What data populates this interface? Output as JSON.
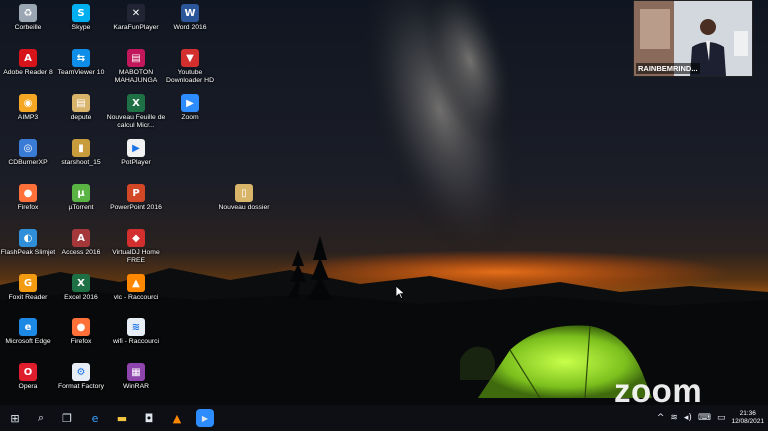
{
  "desktop": {
    "icons": [
      {
        "label": "Corbeille",
        "icon": "recycle-bin-icon",
        "color": "#9aa7b3",
        "glyph": "♻"
      },
      {
        "label": "Skype",
        "icon": "skype-icon",
        "color": "#00aff0",
        "glyph": "S"
      },
      {
        "label": "KaraFunPlayer",
        "icon": "karafun-icon",
        "color": "#202433",
        "glyph": "✕"
      },
      {
        "label": "Word 2016",
        "icon": "word-icon",
        "color": "#2b579a",
        "glyph": "W"
      },
      {
        "label": "Adobe Reader 8",
        "icon": "adobe-reader-icon",
        "color": "#d7141a",
        "glyph": "A"
      },
      {
        "label": "TeamViewer 10",
        "icon": "teamviewer-icon",
        "color": "#0e8ee9",
        "glyph": "⇆"
      },
      {
        "label": "MABOTON MAHAJUNGA",
        "icon": "media-file-icon",
        "color": "#c2185b",
        "glyph": "▤"
      },
      {
        "label": "Youtube Downloader HD",
        "icon": "youtube-downloader-icon",
        "color": "#d32f2f",
        "glyph": "▼"
      },
      {
        "label": "AIMP3",
        "icon": "aimp-icon",
        "color": "#f5a623",
        "glyph": "◉"
      },
      {
        "label": "depute",
        "icon": "document-icon",
        "color": "#d8b36a",
        "glyph": "▤"
      },
      {
        "label": "Nouveau Feuille de calcul Micr...",
        "icon": "excel-file-icon",
        "color": "#1e7145",
        "glyph": "X"
      },
      {
        "label": "Zoom",
        "icon": "zoom-icon",
        "color": "#2d8cff",
        "glyph": "▶"
      },
      {
        "label": "CDBurnerXP",
        "icon": "cdburner-icon",
        "color": "#3a7bd5",
        "glyph": "◎"
      },
      {
        "label": "starshoot_15",
        "icon": "folder-file-icon",
        "color": "#c89b3c",
        "glyph": "▮"
      },
      {
        "label": "PotPlayer",
        "icon": "potplayer-icon",
        "color": "#f2f2f2",
        "glyph": "▶"
      },
      {
        "label": "Firefox",
        "icon": "firefox-icon",
        "color": "#ff7139",
        "glyph": "●"
      },
      {
        "label": "µTorrent",
        "icon": "utorrent-icon",
        "color": "#59b443",
        "glyph": "µ"
      },
      {
        "label": "PowerPoint 2016",
        "icon": "powerpoint-icon",
        "color": "#d24726",
        "glyph": "P"
      },
      {
        "label": "Nouveau dossier",
        "icon": "folder-icon",
        "color": "#d9b56a",
        "glyph": "▯"
      },
      {
        "label": "FlashPeak Slimjet",
        "icon": "slimjet-icon",
        "color": "#2f8fd8",
        "glyph": "◐"
      },
      {
        "label": "Access 2016",
        "icon": "access-icon",
        "color": "#a4373a",
        "glyph": "A"
      },
      {
        "label": "VirtualDJ Home FREE",
        "icon": "virtualdj-icon",
        "color": "#d32f2f",
        "glyph": "◆"
      },
      {
        "label": "Foxit Reader",
        "icon": "foxit-icon",
        "color": "#f39c12",
        "glyph": "G"
      },
      {
        "label": "Excel 2016",
        "icon": "excel-icon",
        "color": "#1e7145",
        "glyph": "X"
      },
      {
        "label": "vlc - Raccourci",
        "icon": "vlc-icon",
        "color": "#ff8800",
        "glyph": "▲"
      },
      {
        "label": "Microsoft Edge",
        "icon": "edge-icon",
        "color": "#1e88e5",
        "glyph": "e"
      },
      {
        "label": "Firefox",
        "icon": "firefox-icon",
        "color": "#ff7139",
        "glyph": "●"
      },
      {
        "label": "wifi - Raccourci",
        "icon": "wifi-shortcut-icon",
        "color": "#e8eef5",
        "glyph": "≋"
      },
      {
        "label": "Opera",
        "icon": "opera-icon",
        "color": "#e01d2c",
        "glyph": "O"
      },
      {
        "label": "Format Factory",
        "icon": "format-factory-icon",
        "color": "#e8eef5",
        "glyph": "⚙"
      },
      {
        "label": "WinRAR",
        "icon": "winrar-icon",
        "color": "#8e44ad",
        "glyph": "▦"
      }
    ]
  },
  "video_overlay": {
    "participant_name": "RAINBEMRIND...",
    "brand": "zoom"
  },
  "taskbar": {
    "items": [
      {
        "icon": "windows-start-icon",
        "glyph": "⊞"
      },
      {
        "icon": "search-icon",
        "glyph": "⌕"
      },
      {
        "icon": "task-view-icon",
        "glyph": "❐"
      },
      {
        "icon": "edge-icon",
        "glyph": "e"
      },
      {
        "icon": "file-explorer-icon",
        "glyph": "▬"
      },
      {
        "icon": "store-icon",
        "glyph": "◘"
      },
      {
        "icon": "vlc-icon",
        "glyph": "▲"
      },
      {
        "icon": "zoom-icon",
        "glyph": "▶"
      }
    ],
    "tray_icons": [
      {
        "icon": "chevron-up-icon",
        "glyph": "^"
      },
      {
        "icon": "network-icon",
        "glyph": "≋"
      },
      {
        "icon": "volume-icon",
        "glyph": "◂)"
      },
      {
        "icon": "keyboard-icon",
        "glyph": "⌨"
      },
      {
        "icon": "notification-icon",
        "glyph": "▭"
      }
    ],
    "time": "21:36",
    "date": "12/08/2021"
  }
}
